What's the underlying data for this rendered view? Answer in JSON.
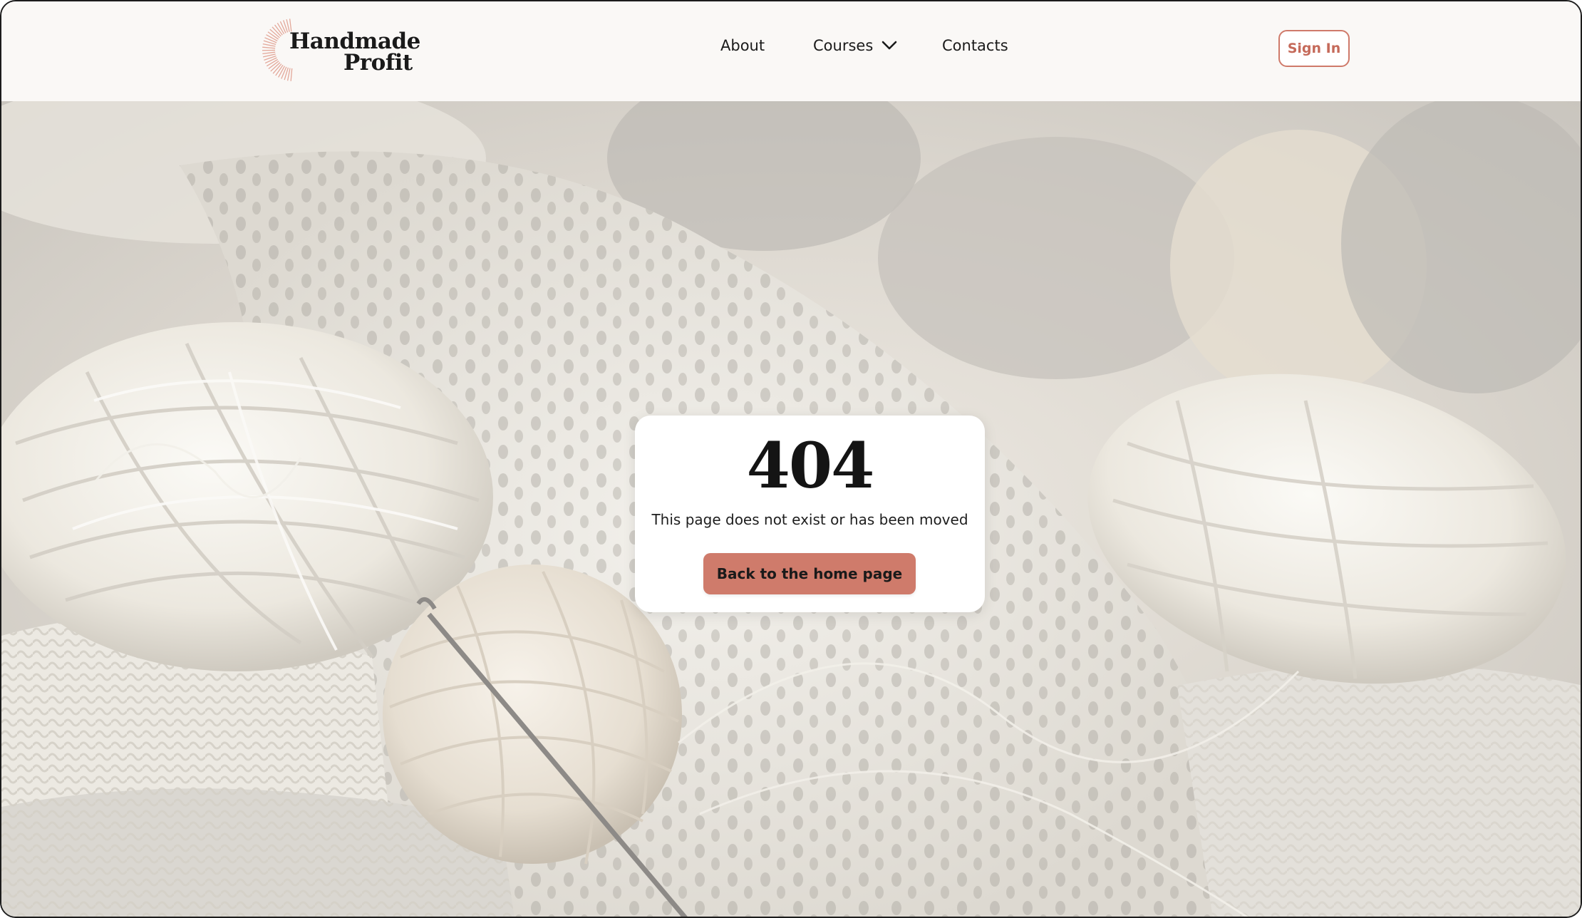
{
  "header": {
    "logo": {
      "line1": "Handmade",
      "line2": "Profit"
    },
    "nav": {
      "about": "About",
      "courses": "Courses",
      "contacts": "Contacts"
    },
    "sign_in_label": "Sign In"
  },
  "error": {
    "code": "404",
    "message": "This page does not exist or has been moved",
    "back_button_label": "Back to the home page"
  },
  "icons": {
    "courses_dropdown": "chevron-down-icon",
    "logo_mark": "sunburst-icon"
  },
  "colors": {
    "accent": "#cf7b6b",
    "accent_text": "#c56a5a",
    "header_bg": "#faf8f6",
    "card_bg": "#ffffff"
  }
}
